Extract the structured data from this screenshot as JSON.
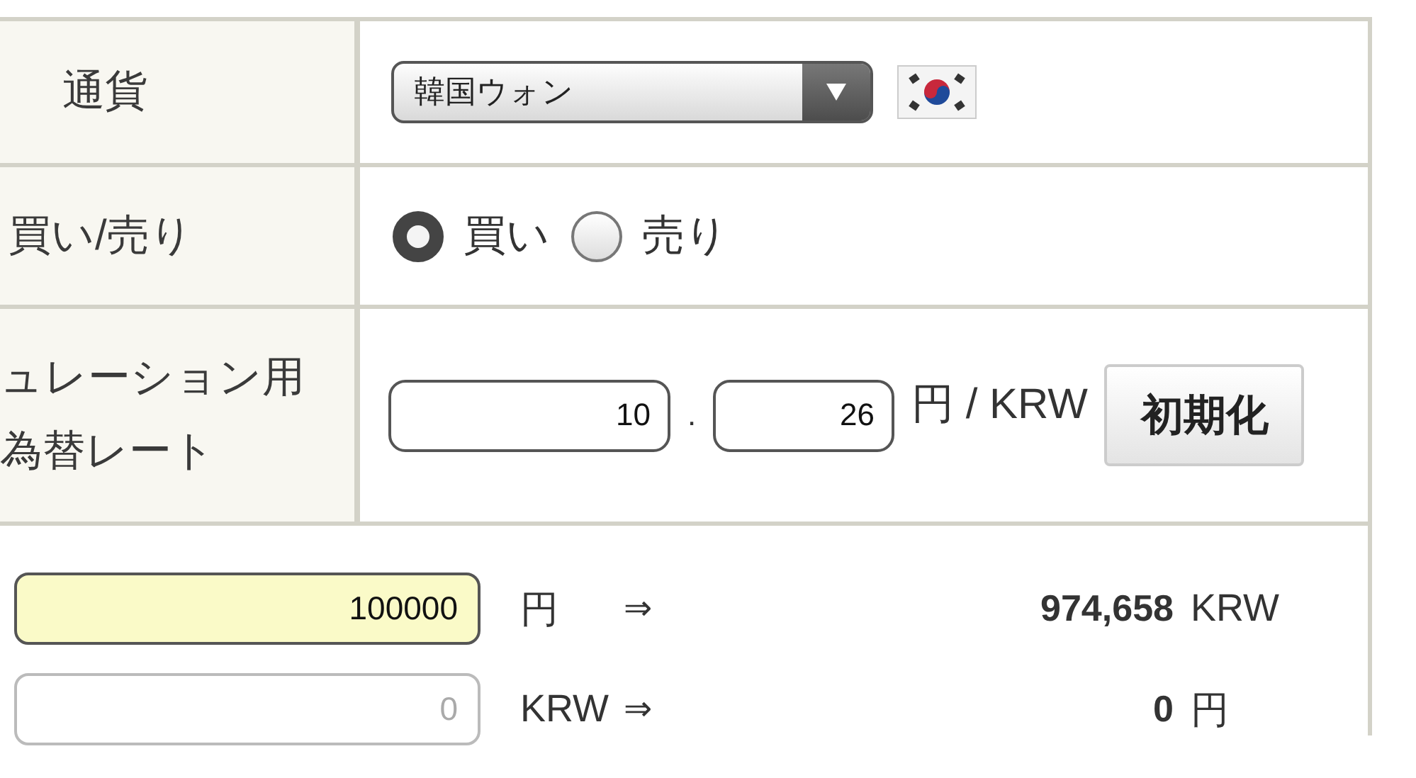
{
  "currency": {
    "label": "通貨",
    "select": {
      "value": "韓国ウォン"
    }
  },
  "trade": {
    "label": "買い/売り",
    "options": [
      {
        "label": "買い",
        "selected": true
      },
      {
        "label": "売り",
        "selected": false
      }
    ]
  },
  "rate": {
    "label": "ュレーション用為替レート",
    "integer": "10",
    "separator": ".",
    "decimal": "26",
    "unit": "円 / KRW",
    "reset_button": "初期化"
  },
  "conversions": [
    {
      "input": {
        "value": "100000",
        "active": true
      },
      "unit": "円",
      "arrow": "⇒",
      "result": "974,658",
      "result_unit": "KRW"
    },
    {
      "input": {
        "placeholder": "0",
        "active": false
      },
      "unit": "KRW",
      "arrow": "⇒",
      "result": "0",
      "result_unit": "円"
    }
  ]
}
